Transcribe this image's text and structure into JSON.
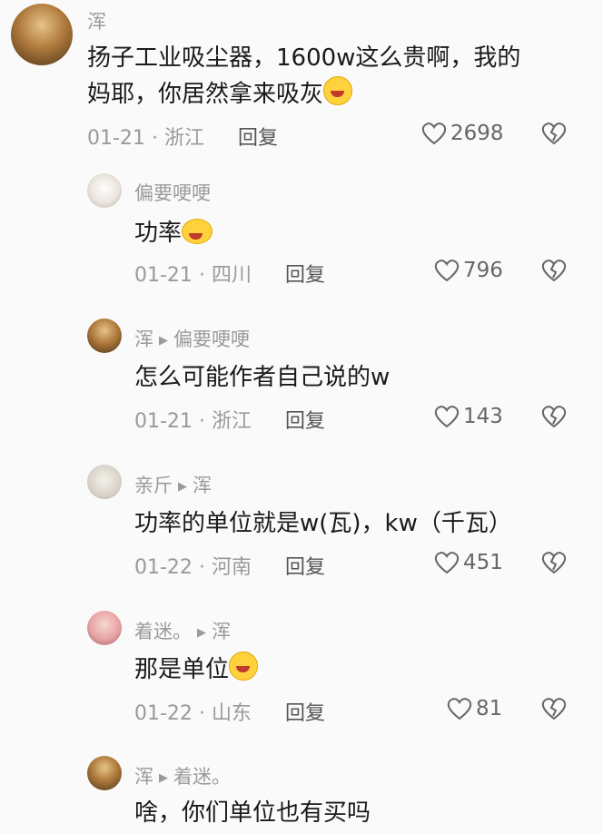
{
  "comments": [
    {
      "name": "浑",
      "text_line1": "扬子工业吸尘器，1600w这么贵啊，我的",
      "text_line2": "妈耶，你居然拿来吸灰",
      "date": "01-21",
      "location": "浙江",
      "reply": "回复",
      "likes": "2698"
    },
    {
      "name": "偏要哽哽",
      "text": "功率",
      "date": "01-21",
      "location": "四川",
      "reply": "回复",
      "likes": "796"
    },
    {
      "name": "浑",
      "reply_to": "偏要哽哽",
      "text": "怎么可能作者自己说的w",
      "date": "01-21",
      "location": "浙江",
      "reply": "回复",
      "likes": "143"
    },
    {
      "name": "亲斤",
      "reply_to": "浑",
      "text": "功率的单位就是w(瓦)，kw（千瓦）",
      "date": "01-22",
      "location": "河南",
      "reply": "回复",
      "likes": "451"
    },
    {
      "name": "着迷。",
      "reply_to": "浑",
      "text": "那是单位",
      "date": "01-22",
      "location": "山东",
      "reply": "回复",
      "likes": "81"
    },
    {
      "name": "浑",
      "reply_to": "着迷。",
      "text": "啥，你们单位也有买吗"
    }
  ],
  "separator": "·",
  "icons": {
    "like": "heart-outline-icon",
    "dislike": "broken-heart-icon",
    "reply_arrow": "triangle-right-icon"
  }
}
